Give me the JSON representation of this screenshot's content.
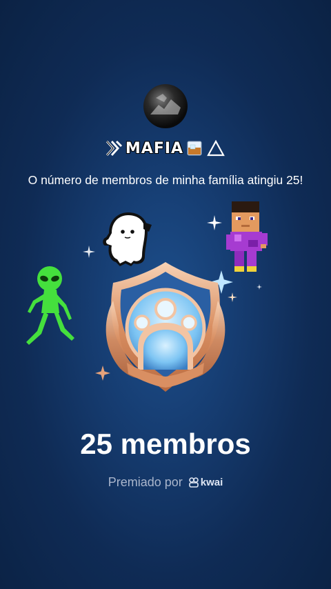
{
  "family": {
    "name": "MAFIA",
    "message": "O número de membros de minha família atingiu 25!"
  },
  "badge": {
    "title": "25 membros",
    "awarded_by_label": "Premiado por",
    "brand": "kwai"
  },
  "icons": [
    "avatar",
    "mafia-logo-icon",
    "whiskey-glass-icon",
    "triangle-icon",
    "sticker-ghost",
    "sticker-alien",
    "sticker-pixel-boy",
    "family-badge-icon",
    "sparkle-icon",
    "kwai-logo-icon"
  ],
  "colors": {
    "background": "#163d72",
    "badge_gold": "#e3a77a",
    "badge_blue": "#7cc4f3",
    "alien_green": "#45e03d",
    "subtitle_gray": "#aab6cc"
  }
}
